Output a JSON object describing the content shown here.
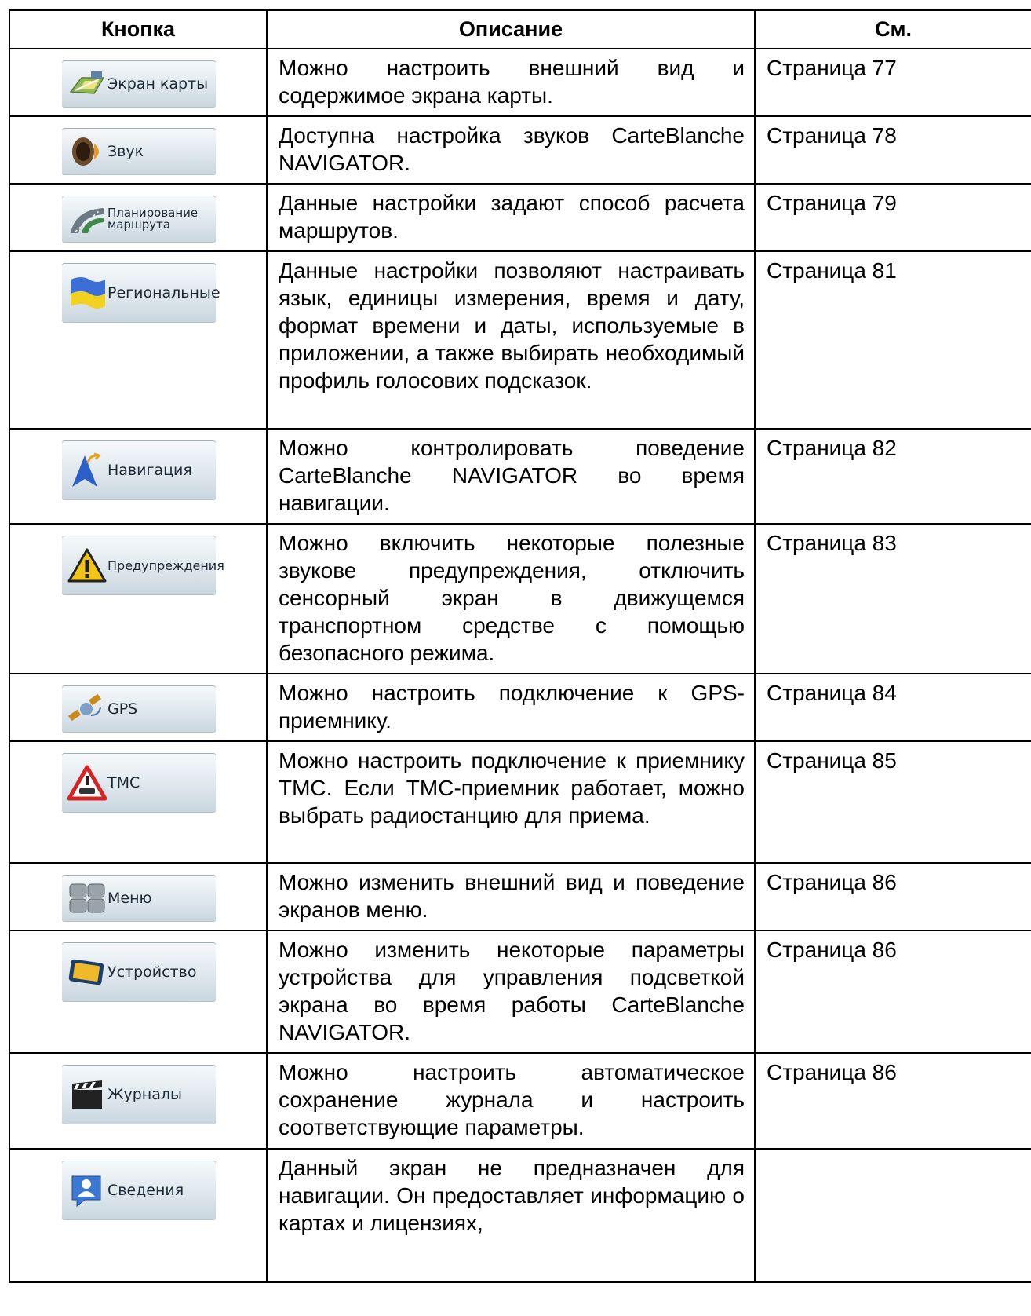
{
  "table": {
    "headers": [
      "Кнопка",
      "Описание",
      "См."
    ],
    "rows": [
      {
        "icon": "map-screen-icon",
        "button": "Экран карты",
        "description": "Можно настроить внешний вид и содержимое экрана карты.",
        "see": "Страница 77"
      },
      {
        "icon": "speaker-icon",
        "button": "Звук",
        "description": "Доступна настройка звуков CarteBlanche NAVIGATOR.",
        "see": "Страница 78"
      },
      {
        "icon": "route-icon",
        "button": "Планирование маршрута",
        "description": "Данные настройки задают способ расчета маршрутов.",
        "see": "Страница 79"
      },
      {
        "icon": "flag-icon",
        "button": "Региональные",
        "description": "Данные настройки позволяют настраивать язык, единицы измерения, время и дату, формат времени и даты, используемые в приложении, а также выбирать необходимый профиль голосових подсказок.",
        "see": "Страница 81"
      },
      {
        "icon": "navigation-arrow-icon",
        "button": "Навигация",
        "description": "Можно контролировать поведение CarteBlanche NAVIGATOR во время навигации.",
        "see": "Страница 82"
      },
      {
        "icon": "warning-icon",
        "button": "Предупреждения",
        "description": "Можно включить некоторые полезные звукове предупреждения, отключить сенсорный экран в движущемся транспортном средстве с помощью безопасного режима.",
        "see": "Страница 83"
      },
      {
        "icon": "satellite-icon",
        "button": "GPS",
        "description": "Можно настроить подключение к GPS-приемнику.",
        "see": "Страница 84"
      },
      {
        "icon": "traffic-sign-icon",
        "button": "TMC",
        "description": "Можно настроить подключение к приемнику TMC. Если TMC-приемник работает, можно выбрать радиостанцию для приема.",
        "see": "Страница 85"
      },
      {
        "icon": "menu-grid-icon",
        "button": "Меню",
        "description": "Можно изменить внешний вид и поведение экранов меню.",
        "see": "Страница 86"
      },
      {
        "icon": "device-icon",
        "button": "Устройство",
        "description": "Можно изменить некоторые параметры устройства для управления подсветкой экрана во время работы CarteBlanche NAVIGATOR.",
        "see": "Страница 86"
      },
      {
        "icon": "clapperboard-icon",
        "button": "Журналы",
        "description": "Можно настроить автоматическое сохранение журнала и настроить соответствующие параметры.",
        "see": "Страница 86"
      },
      {
        "icon": "info-person-icon",
        "button": "Сведения",
        "description": "Данный экран не предназначен для навигации. Он предоставляет информацию о картах и лицензиях,",
        "see": ""
      }
    ]
  }
}
